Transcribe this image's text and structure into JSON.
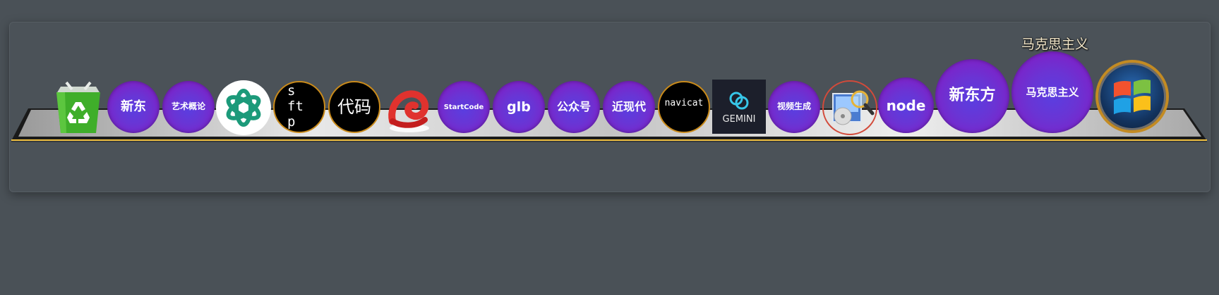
{
  "tooltip": "马克思主义",
  "dock": {
    "xindong": "新东",
    "yishu": "艺术概论",
    "sftp": [
      "s",
      "ft",
      "p"
    ],
    "daima": "代码",
    "startcode": "StartCode",
    "glb": "glb",
    "gongzhonghao": "公众号",
    "jinxiandai": "近现代",
    "navicat": "navicat",
    "gemini": "GEMINI",
    "shipin": "视频生成",
    "node": "node",
    "xindongfang": "新东方",
    "makesi": "马克思主义"
  },
  "colors": {
    "background": "#4a5157",
    "bubble_purple": "#7a2ccc",
    "black_ring": "#c98a1a",
    "recycle_green": "#3fae2a",
    "chatgpt_green": "#1c9a7a"
  },
  "icons": [
    "recycle-bin-icon",
    "chatgpt-icon",
    "swirl-app-icon",
    "gemini-icon",
    "disk-search-icon",
    "windows-start-icon"
  ]
}
